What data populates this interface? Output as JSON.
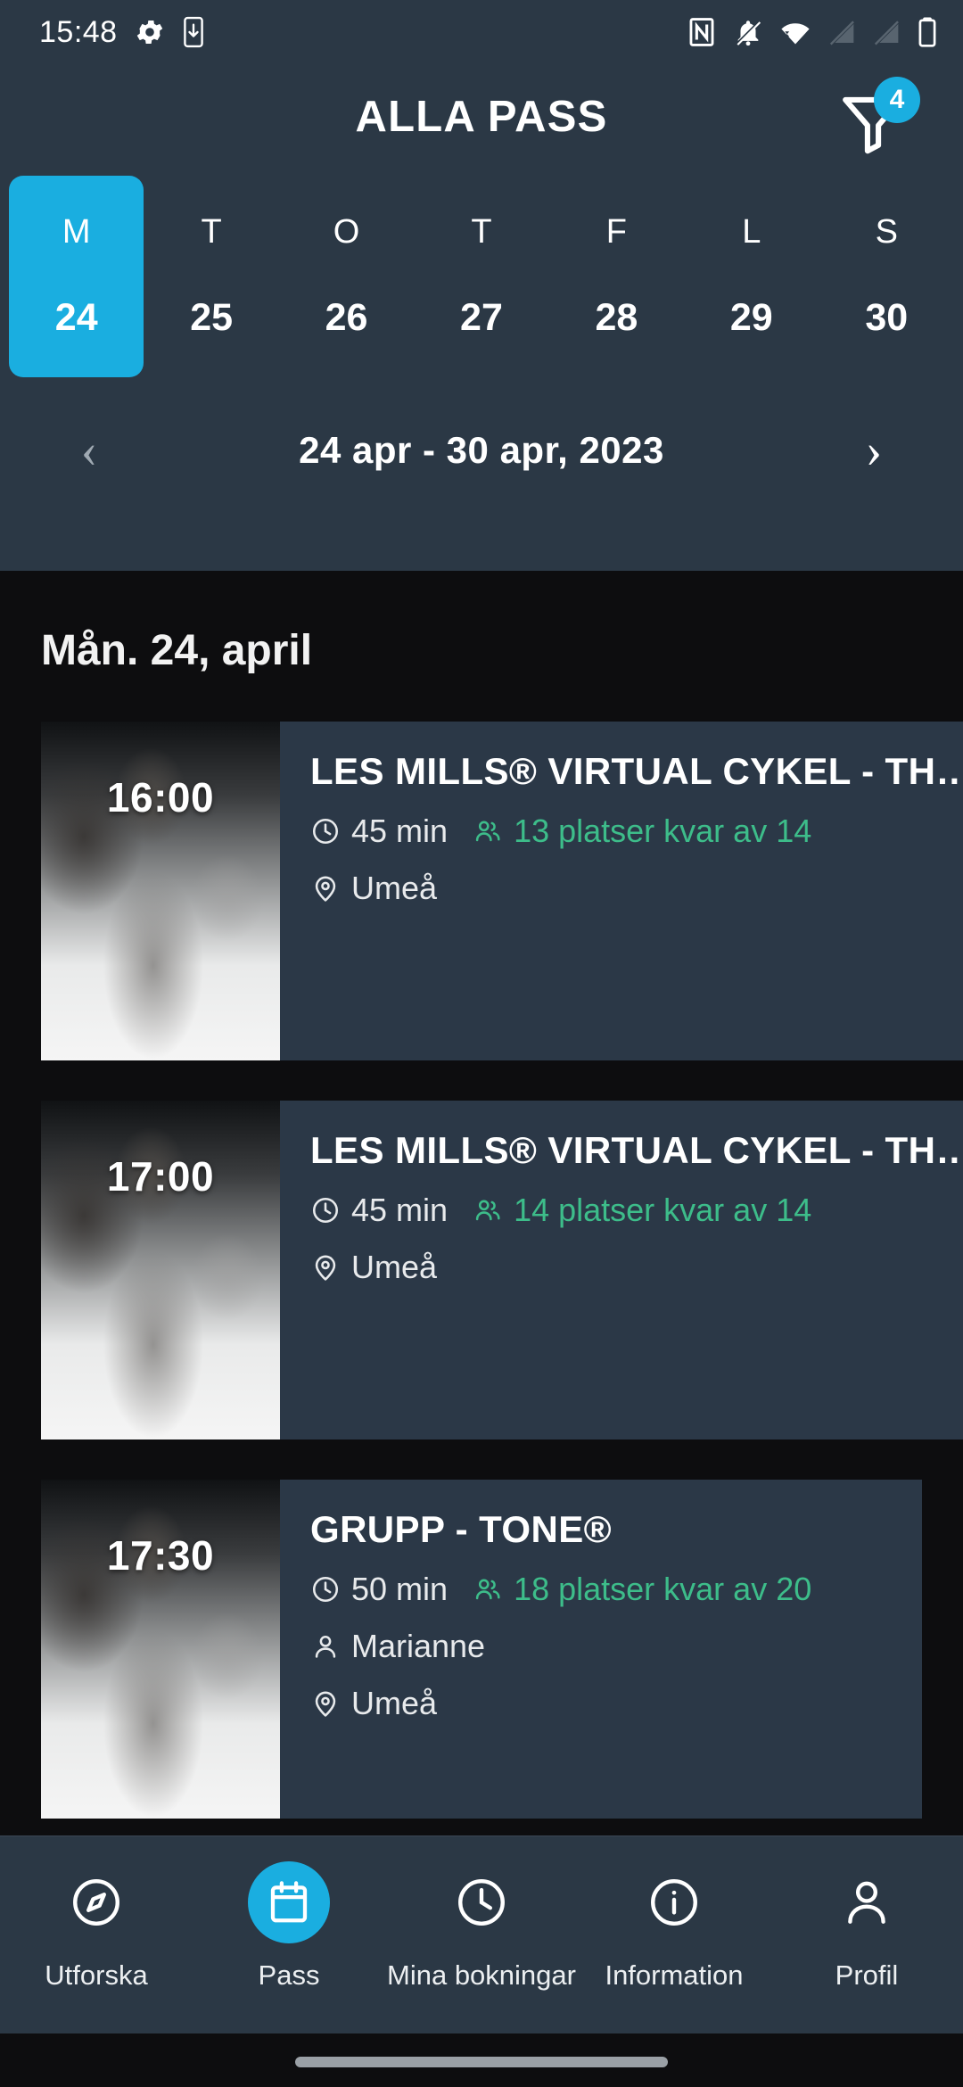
{
  "status_bar": {
    "time": "15:48",
    "left_icons": [
      "gear-icon",
      "phone-download-icon"
    ],
    "right_icons": [
      "nfc-icon",
      "notifications-off-icon",
      "wifi-icon",
      "signal-off-1-icon",
      "signal-off-2-icon",
      "battery-icon"
    ]
  },
  "header": {
    "title": "ALLA PASS",
    "filter": {
      "icon": "filter-funnel-icon",
      "badge_count": "4"
    },
    "background_color": "#2b3845",
    "accent_color": "#1aaee0"
  },
  "day_strip": {
    "days": [
      {
        "dow": "M",
        "date": "24",
        "selected": true
      },
      {
        "dow": "T",
        "date": "25",
        "selected": false
      },
      {
        "dow": "O",
        "date": "26",
        "selected": false
      },
      {
        "dow": "T",
        "date": "27",
        "selected": false
      },
      {
        "dow": "F",
        "date": "28",
        "selected": false
      },
      {
        "dow": "L",
        "date": "29",
        "selected": false
      },
      {
        "dow": "S",
        "date": "30",
        "selected": false
      }
    ]
  },
  "week_nav": {
    "prev_icon": "chevron-left-icon",
    "range_label": "24 apr - 30 apr, 2023",
    "next_icon": "chevron-right-icon"
  },
  "content": {
    "date_heading": "Mån. 24, april",
    "background_color": "#0d0d0f",
    "card_color": "#2b3847",
    "availability_color": "#3dbd8a",
    "classes": [
      {
        "time": "16:00",
        "title": "LES MILLS® VIRTUAL CYKEL - TH…",
        "duration": "45 min",
        "availability": "13 platser kvar av 14",
        "instructor": "",
        "location": "Umeå"
      },
      {
        "time": "17:00",
        "title": "LES MILLS® VIRTUAL CYKEL - TH…",
        "duration": "45 min",
        "availability": "14 platser kvar av 14",
        "instructor": "",
        "location": "Umeå"
      },
      {
        "time": "17:30",
        "title": "GRUPP - TONE®",
        "duration": "50 min",
        "availability": "18 platser kvar av 20",
        "instructor": "Marianne",
        "location": "Umeå"
      }
    ]
  },
  "bottom_nav": {
    "items": [
      {
        "label": "Utforska",
        "icon": "compass-icon",
        "active": false
      },
      {
        "label": "Pass",
        "icon": "calendar-icon",
        "active": true
      },
      {
        "label": "Mina bokningar",
        "icon": "clock-icon",
        "active": false
      },
      {
        "label": "Information",
        "icon": "info-icon",
        "active": false
      },
      {
        "label": "Profil",
        "icon": "person-icon",
        "active": false
      }
    ]
  }
}
